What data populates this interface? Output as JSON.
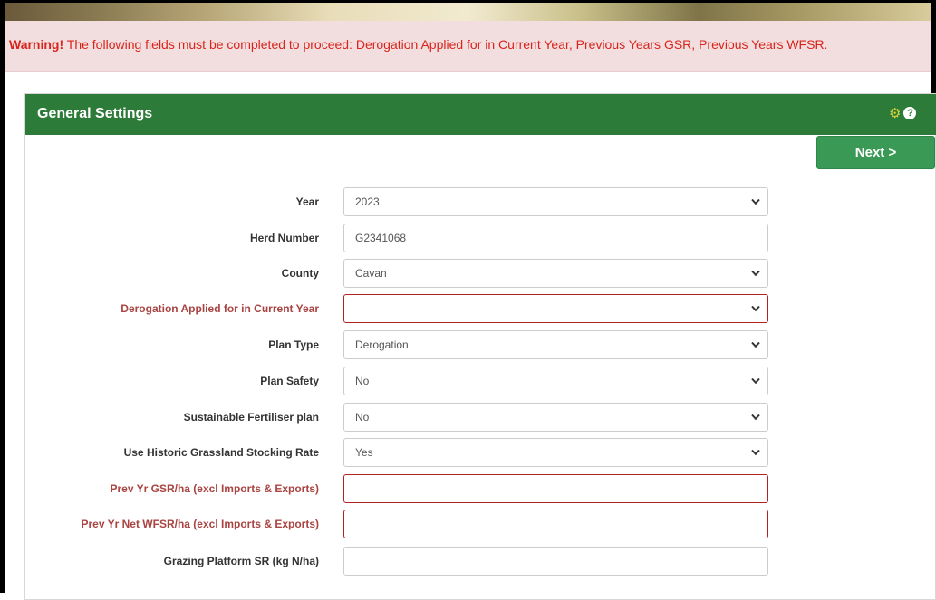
{
  "alert": {
    "strong": "Warning!",
    "message": " The following fields must be completed to proceed: Derogation Applied for in Current Year, Previous Years GSR, Previous Years WFSR."
  },
  "panel": {
    "title": "General Settings",
    "next_label": "Next >",
    "icons": [
      "gear-icon",
      "help-icon"
    ]
  },
  "colors": {
    "header_green": "#2d7b38",
    "next_button": "#3a9a55",
    "alert_bg": "#f2dede",
    "alert_text": "#d9241c",
    "error_label": "#a94442",
    "error_border": "#b22222"
  },
  "form": {
    "year": {
      "label": "Year",
      "value": "2023"
    },
    "herd_number": {
      "label": "Herd Number",
      "value": "G2341068"
    },
    "county": {
      "label": "County",
      "value": "Cavan"
    },
    "derogation_current_year": {
      "label": "Derogation Applied for in Current Year",
      "value": ""
    },
    "plan_type": {
      "label": "Plan Type",
      "value": "Derogation"
    },
    "plan_safety": {
      "label": "Plan Safety",
      "value": "No"
    },
    "sustainable_fertiliser_plan": {
      "label": "Sustainable Fertiliser plan",
      "value": "No"
    },
    "historic_grassland_stocking_rate": {
      "label": "Use Historic Grassland Stocking Rate",
      "value": "Yes"
    },
    "prev_yr_gsr": {
      "label": "Prev Yr GSR/ha (excl Imports & Exports)",
      "value": ""
    },
    "prev_yr_net_wfsr": {
      "label": "Prev Yr Net WFSR/ha (excl Imports & Exports)",
      "value": ""
    },
    "grazing_platform_sr": {
      "label": "Grazing Platform SR (kg N/ha)",
      "value": ""
    }
  }
}
